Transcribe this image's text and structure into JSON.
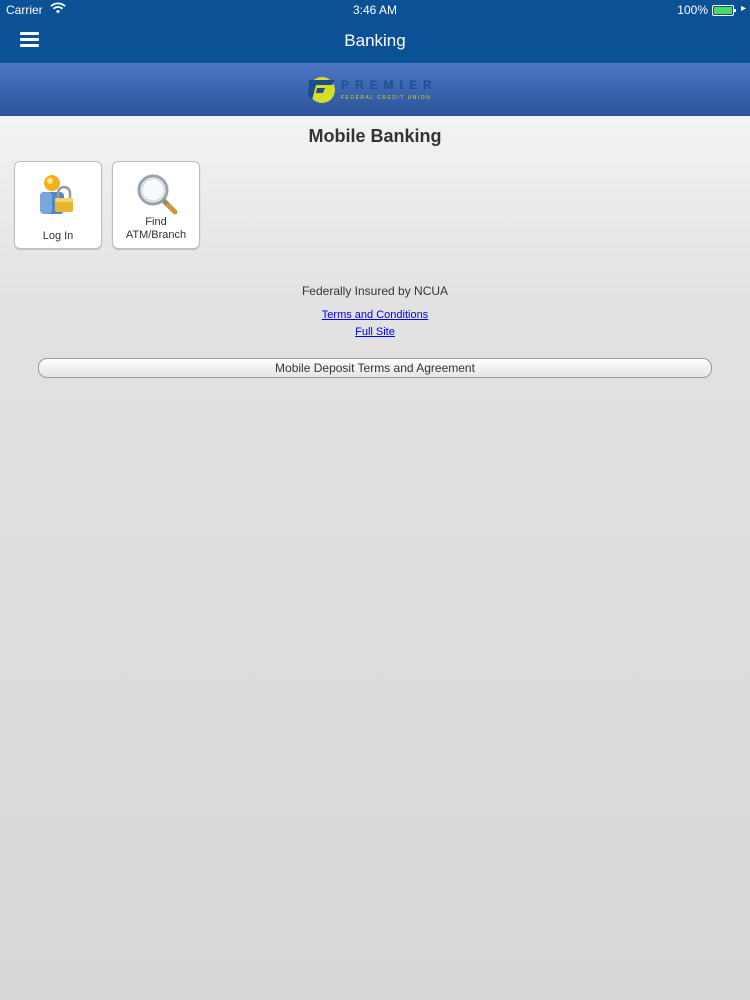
{
  "status_bar": {
    "carrier": "Carrier",
    "time": "3:46 AM",
    "battery": "100%",
    "icons": [
      "wifi-icon",
      "battery-icon",
      "charging-icon"
    ]
  },
  "nav": {
    "title": "Banking",
    "menu_icon": "hamburger-menu-icon"
  },
  "logo": {
    "wordmark": "PREMIER",
    "tagline": "FEDERAL CREDIT UNION"
  },
  "main": {
    "title": "Mobile Banking",
    "tiles": [
      {
        "label": "Log In",
        "icon": "user-lock-icon"
      },
      {
        "label_lines": [
          "Find",
          "ATM/Branch"
        ],
        "icon": "magnifier-icon"
      }
    ],
    "insured_text": "Federally Insured by NCUA",
    "links": {
      "terms": "Terms and Conditions",
      "full_site": "Full Site"
    },
    "deposit_button": "Mobile Deposit Terms and Agreement"
  },
  "colors": {
    "nav_bar": "#0a5196",
    "logo_band": "#3a63ad",
    "link": "#0000ee",
    "battery_fill": "#4cd964",
    "logo_yellow": "#d7dd26"
  }
}
